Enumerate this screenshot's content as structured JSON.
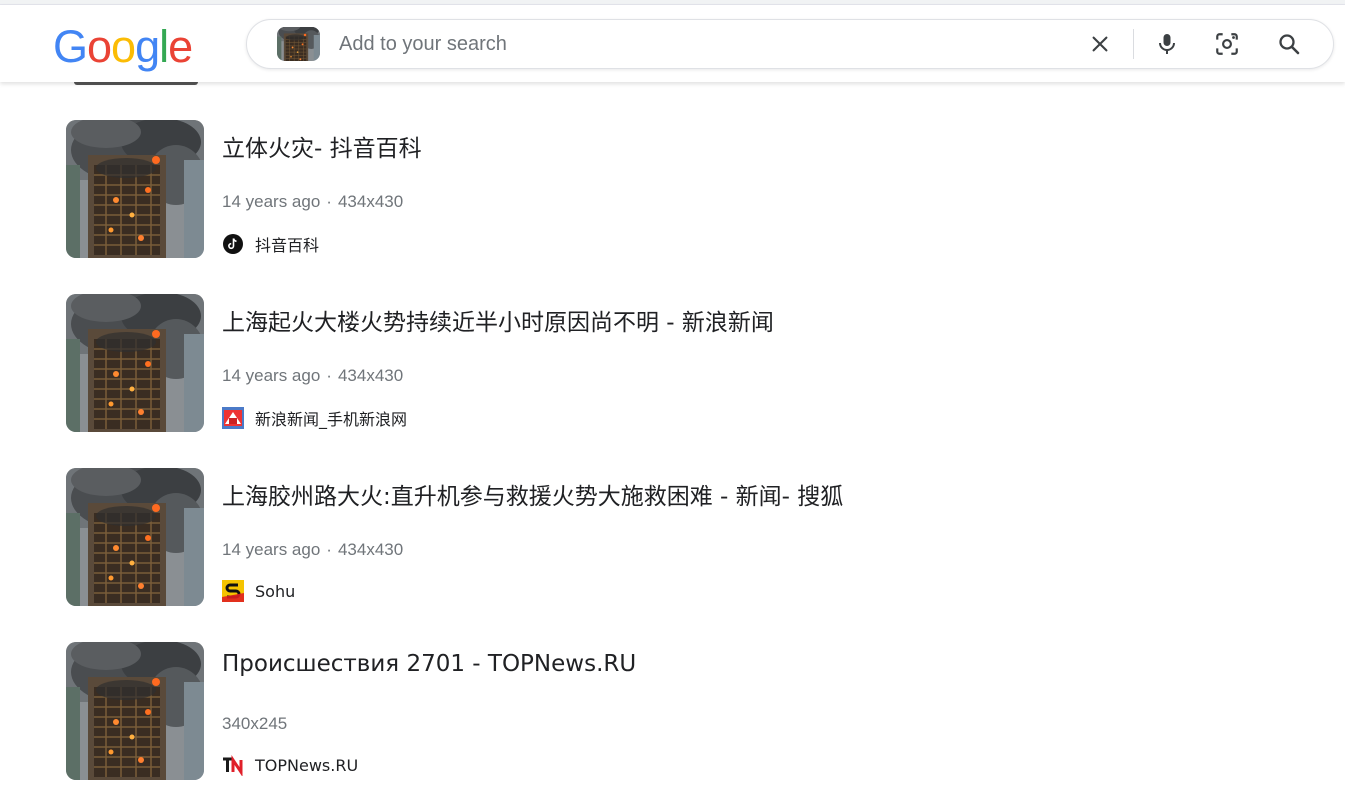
{
  "colors": {
    "blue": "#4285F4",
    "red": "#EA4335",
    "yellow": "#FBBC05",
    "green": "#34A853",
    "text": "#202124",
    "meta": "#70757a"
  },
  "logo": {
    "letters": [
      "G",
      "o",
      "o",
      "g",
      "l",
      "e"
    ]
  },
  "search": {
    "placeholder": "Add to your search",
    "icons": [
      "close-icon",
      "microphone-icon",
      "lens-icon",
      "search-icon"
    ]
  },
  "results": [
    {
      "title": "立体火灾- 抖音百科",
      "age": "14 years ago",
      "separator": "·",
      "size": "434x430",
      "source": "抖音百科",
      "favicon": "tiktok-icon"
    },
    {
      "title": "上海起火大楼火势持续近半小时原因尚不明 - 新浪新闻",
      "age": "14 years ago",
      "separator": "·",
      "size": "434x430",
      "source": "新浪新闻_手机新浪网",
      "favicon": "sina-icon"
    },
    {
      "title": "上海胶州路大火:直升机参与救援火势大施救困难 - 新闻- 搜狐",
      "age": "14 years ago",
      "separator": "·",
      "size": "434x430",
      "source": "Sohu",
      "favicon": "sohu-icon"
    },
    {
      "title": "Происшествия 2701 - TOPNews.RU",
      "age": "",
      "separator": "",
      "size": "340x245",
      "source": "TOPNews.RU",
      "favicon": "topnews-icon"
    }
  ]
}
